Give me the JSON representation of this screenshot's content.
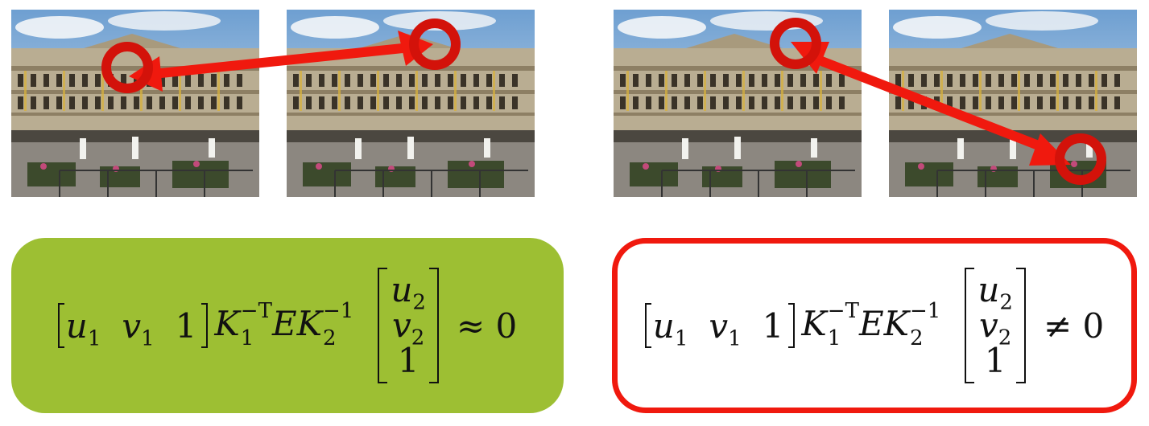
{
  "colors": {
    "arrow_red": "#f0190e",
    "match_box_green": "#9dbf33",
    "mismatch_border_red": "#f0190e",
    "text": "#111111"
  },
  "panels": {
    "left": {
      "equation": {
        "row_vector": [
          "u",
          "1",
          "v",
          "1",
          "1"
        ],
        "k1": "K",
        "k1_sup": "−T",
        "k1_sub": "1",
        "e": "E",
        "k2": "K",
        "k2_sup": "−1",
        "k2_sub": "2",
        "column_vector": [
          "u",
          "2",
          "v",
          "2",
          "1"
        ],
        "relation": "≈ 0"
      }
    },
    "right": {
      "equation": {
        "row_vector": [
          "u",
          "1",
          "v",
          "1",
          "1"
        ],
        "k1": "K",
        "k1_sup": "−T",
        "k1_sub": "1",
        "e": "E",
        "k2": "K",
        "k2_sup": "−1",
        "k2_sub": "2",
        "column_vector": [
          "u",
          "2",
          "v",
          "2",
          "1"
        ],
        "relation": "≠ 0"
      }
    }
  },
  "icons": {
    "match_arrow": "double-headed-arrow-icon",
    "point_marker": "ring-marker-icon"
  }
}
